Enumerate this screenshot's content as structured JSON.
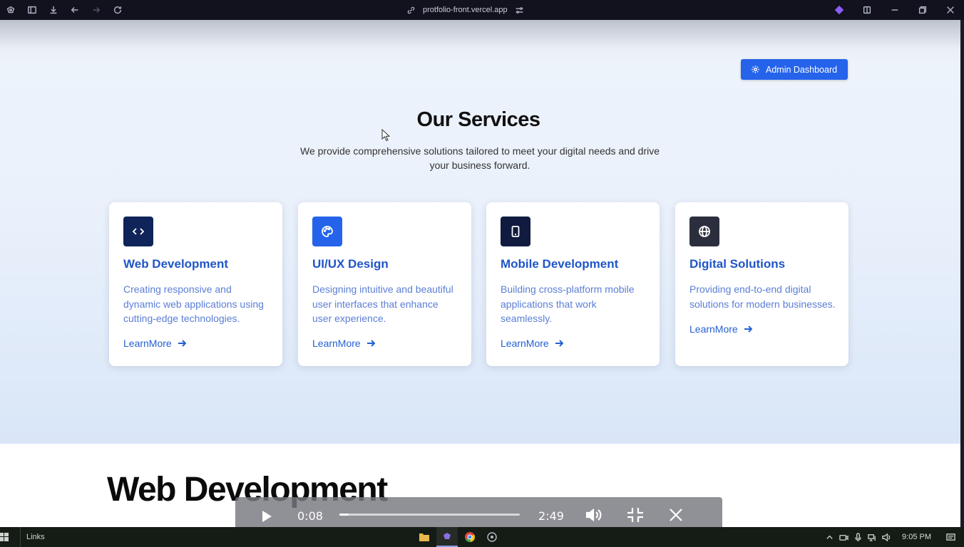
{
  "browser": {
    "url": "protfolio-front.vercel.app"
  },
  "page": {
    "admin_button": "Admin Dashboard",
    "section_title": "Our Services",
    "section_subtitle": "We provide comprehensive solutions tailored to meet your digital needs and drive your business forward.",
    "cards": [
      {
        "title": "Web Development",
        "description": "Creating responsive and dynamic web applications using cutting-edge technologies.",
        "link": "LearnMore",
        "icon": "code-icon",
        "icon_color": "#0f2458"
      },
      {
        "title": "UI/UX Design",
        "description": "Designing intuitive and beautiful user interfaces that enhance user experience.",
        "link": "LearnMore",
        "icon": "palette-icon",
        "icon_color": "#2563eb"
      },
      {
        "title": "Mobile Development",
        "description": "Building cross-platform mobile applications that work seamlessly.",
        "link": "LearnMore",
        "icon": "tablet-icon",
        "icon_color": "#101b3f"
      },
      {
        "title": "Digital Solutions",
        "description": "Providing end-to-end digital solutions for modern businesses.",
        "link": "LearnMore",
        "icon": "globe-icon",
        "icon_color": "#2b2f3d"
      }
    ],
    "next_section_heading": "Web Development"
  },
  "video": {
    "current_time": "0:08",
    "duration": "2:49",
    "progress_fraction": 0.05
  },
  "taskbar": {
    "links_label": "Links",
    "clock": "9:05 PM"
  },
  "colors": {
    "accent": "#2563eb",
    "card_title": "#1f55c7",
    "card_text": "#5b7ed6"
  }
}
